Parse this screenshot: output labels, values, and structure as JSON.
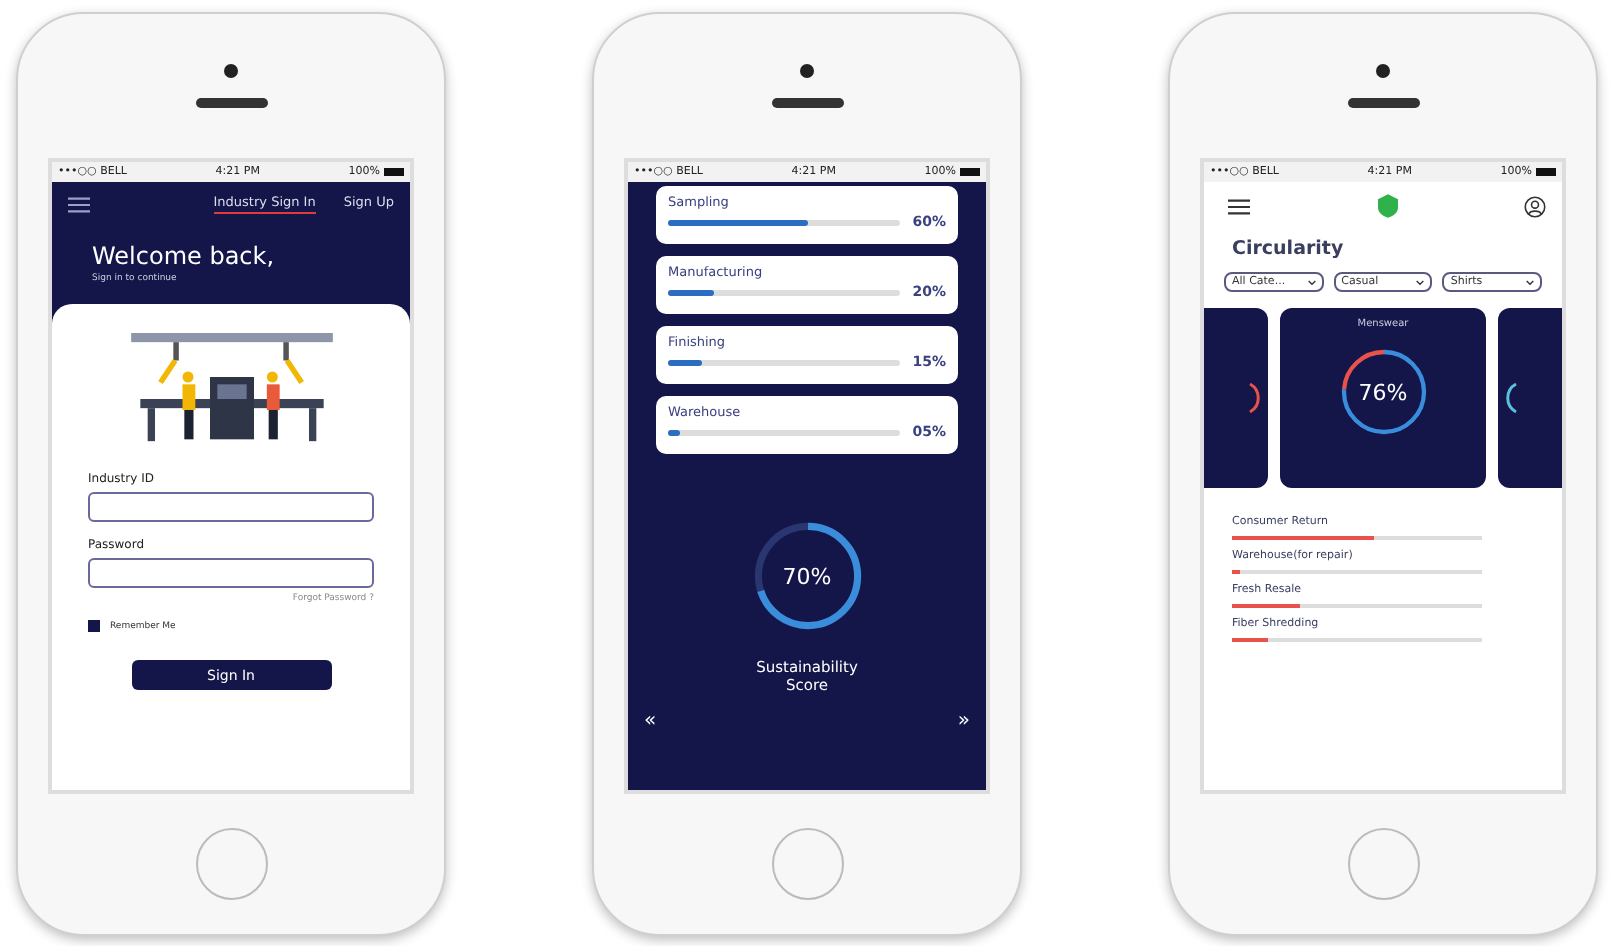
{
  "status_bars": [
    {
      "carrier": "•••○○ BELL",
      "time": "4:21 PM",
      "battery": "100%"
    },
    {
      "carrier": "•••○○ BELL",
      "time": "4:21 PM",
      "battery": "100%"
    },
    {
      "carrier": "•••○○ BELL",
      "time": "4:21 PM",
      "battery": "100%"
    }
  ],
  "login_screen": {
    "tabs": [
      {
        "label": "Industry Sign In",
        "selected": true
      },
      {
        "label": "Sign Up",
        "selected": false
      }
    ],
    "title": "Welcome back,",
    "subtitle": "Sign in to continue",
    "fields": [
      {
        "label": "Industry ID"
      },
      {
        "label": "Password"
      }
    ],
    "forgot_link": "Forgot Password ?",
    "remember": {
      "label": "Remember Me",
      "checked": true
    },
    "button": "Sign In"
  },
  "score_screen": {
    "stages": [
      {
        "name": "Sampling",
        "level": 0.6,
        "reading": "60%"
      },
      {
        "name": "Manufacturing",
        "level": 0.2,
        "reading": "20%"
      },
      {
        "name": "Finishing",
        "level": 0.15,
        "reading": "15%"
      },
      {
        "name": "Warehouse",
        "level": 0.05,
        "reading": "05%"
      }
    ],
    "score": {
      "level": 0.7,
      "reading": "70%",
      "label": "Sustainability Score"
    },
    "prev": "«",
    "next": "»"
  },
  "circularity_screen": {
    "title": "Circularity",
    "filters": [
      "All Cate...",
      "Casual",
      "Shirts"
    ],
    "card": {
      "title": "Menswear",
      "level": 0.76,
      "reading": "76%"
    },
    "items": [
      {
        "name": "Consumer Return",
        "level": 0.57
      },
      {
        "name": "Warehouse(for repair)",
        "level": 0.03
      },
      {
        "name": "Fresh Resale",
        "level": 0.27
      },
      {
        "name": "Fiber Shredding",
        "level": 0.14
      }
    ]
  }
}
